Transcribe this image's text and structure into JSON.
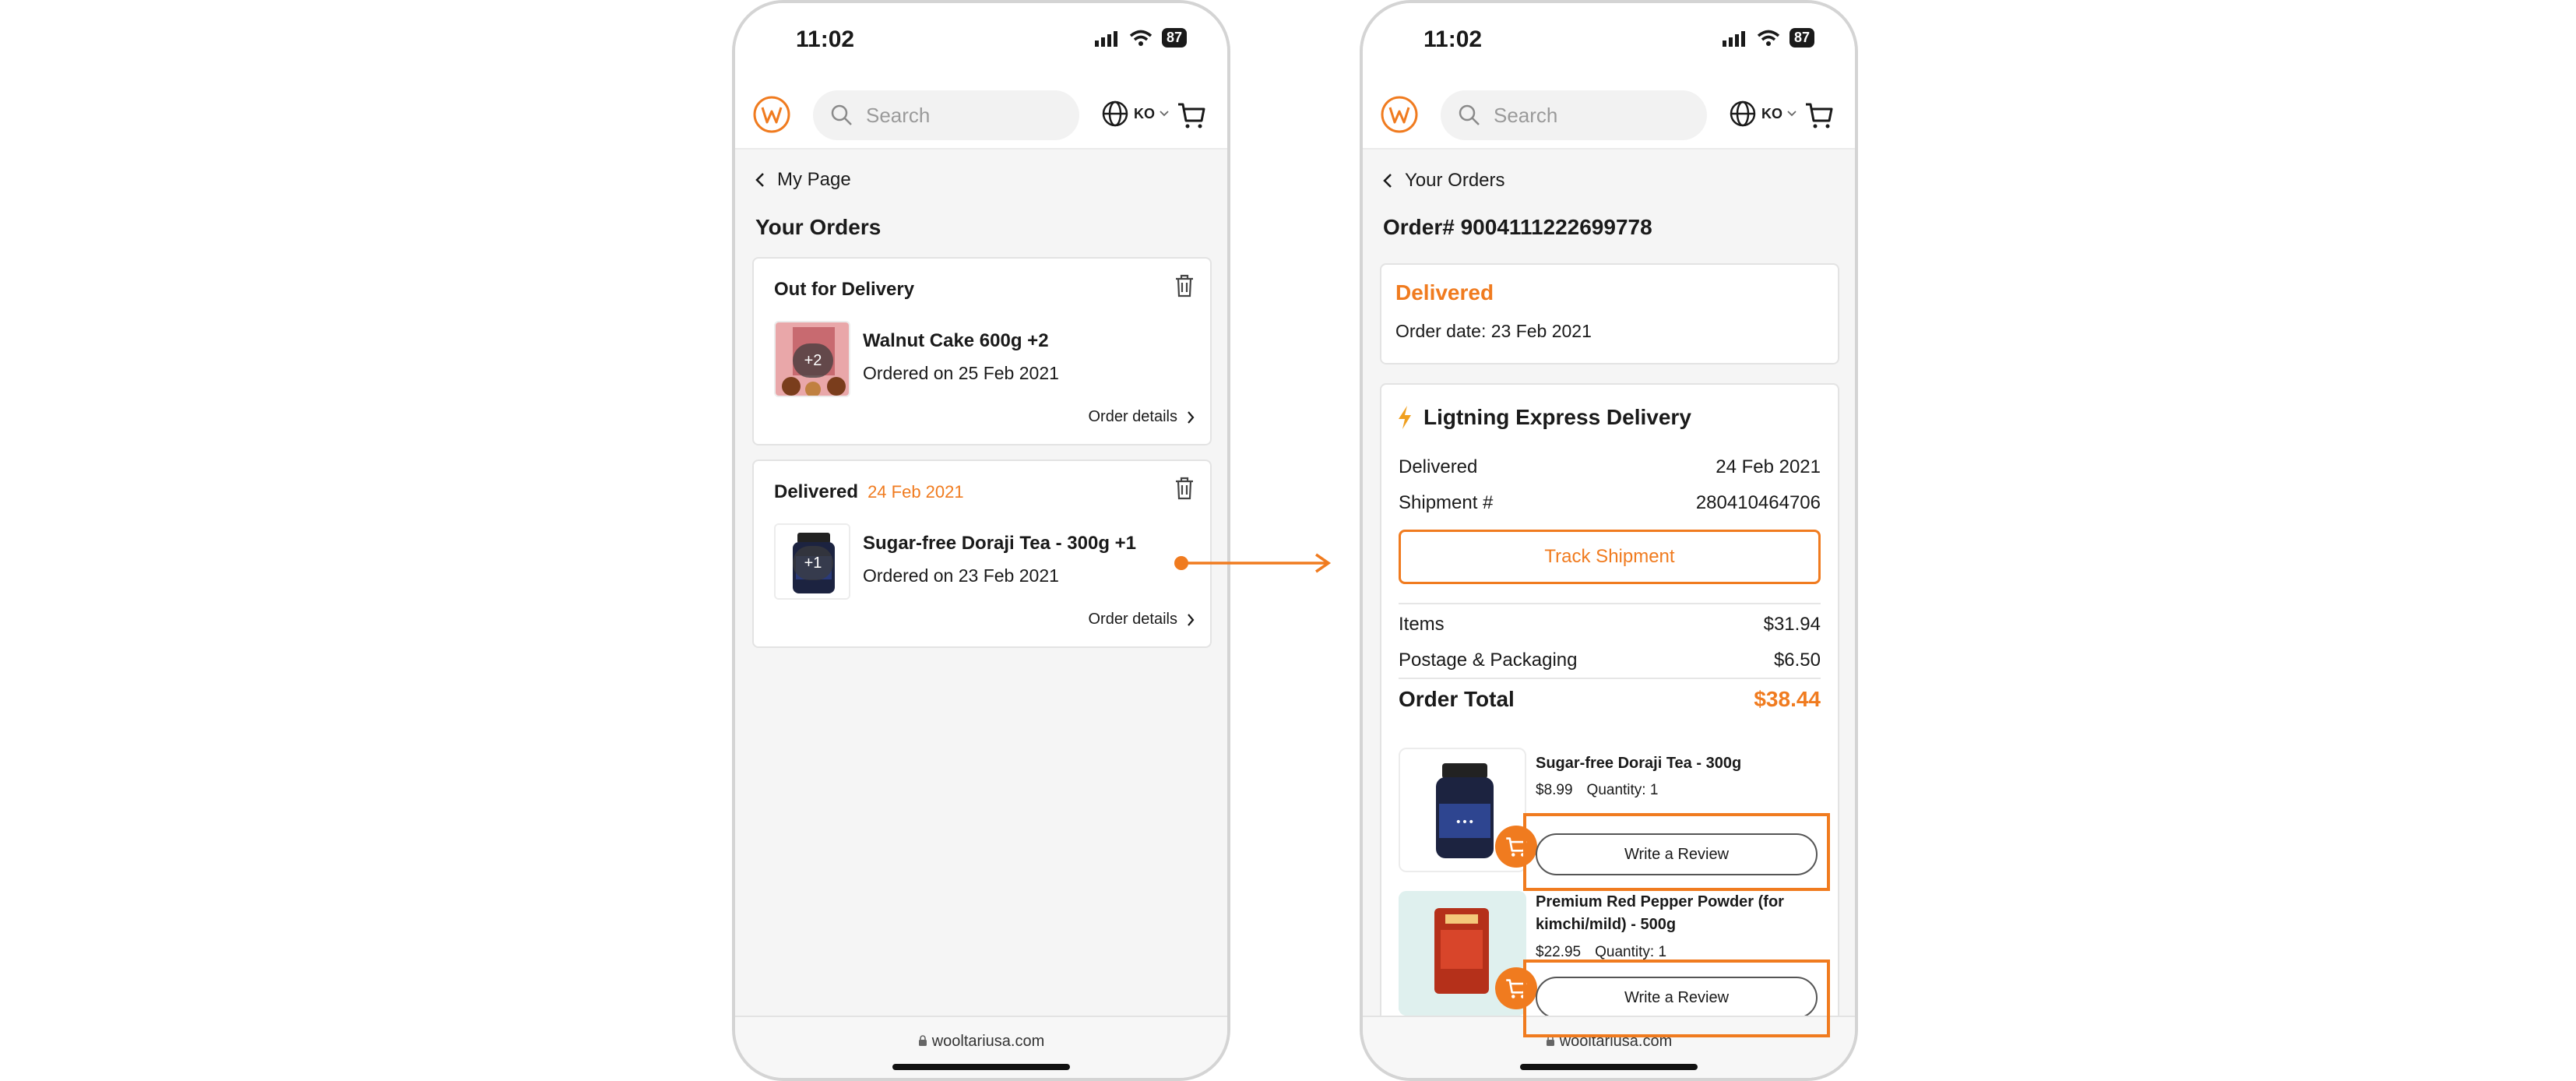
{
  "status_bar": {
    "time": "11:02",
    "battery": "87"
  },
  "header": {
    "search_placeholder": "Search",
    "language": "KO"
  },
  "left_screen": {
    "back_label": "My Page",
    "title": "Your Orders",
    "orders": [
      {
        "status": "Out for Delivery",
        "date": "",
        "item": "Walnut Cake 600g +2",
        "ordered": "Ordered on 25 Feb 2021",
        "badge": "+2",
        "details": "Order details"
      },
      {
        "status": "Delivered",
        "date": "24 Feb 2021",
        "item": "Sugar-free Doraji Tea - 300g +1",
        "ordered": "Ordered on 23 Feb 2021",
        "badge": "+1",
        "details": "Order details"
      }
    ],
    "url": "wooltariusa.com"
  },
  "right_screen": {
    "back_label": "Your Orders",
    "order_number": "Order#  9004111222699778",
    "status": "Delivered",
    "order_date": "Order date: 23 Feb 2021",
    "shipping": {
      "title": "Ligtning Express Delivery",
      "delivered_label": "Delivered",
      "delivered_date": "24 Feb 2021",
      "shipment_label": "Shipment #",
      "shipment_no": "280410464706",
      "track_button": "Track Shipment"
    },
    "summary": {
      "items_label": "Items",
      "items_value": "$31.94",
      "postage_label": "Postage & Packaging",
      "postage_value": "$6.50",
      "total_label": "Order Total",
      "total_value": "$38.44"
    },
    "products": [
      {
        "name": "Sugar-free Doraji Tea - 300g",
        "price": "$8.99",
        "quantity": "Quantity: 1",
        "review_button": "Write a Review"
      },
      {
        "name": "Premium Red Pepper Powder (for kimchi/mild) - 500g",
        "price": "$22.95",
        "quantity": "Quantity: 1",
        "review_button": "Write a Review"
      }
    ],
    "url": "wooltariusa.com"
  },
  "colors": {
    "accent": "#f07b1f",
    "text": "#1a1a1a",
    "background": "#f5f5f5"
  },
  "icons": [
    "signal-icon",
    "wifi-icon",
    "logo-icon",
    "search-icon",
    "globe-icon",
    "chevron-down-icon",
    "cart-icon",
    "chevron-left-icon",
    "trash-icon",
    "chevron-right-icon",
    "lightning-icon",
    "lock-icon",
    "arrow-right-icon"
  ]
}
